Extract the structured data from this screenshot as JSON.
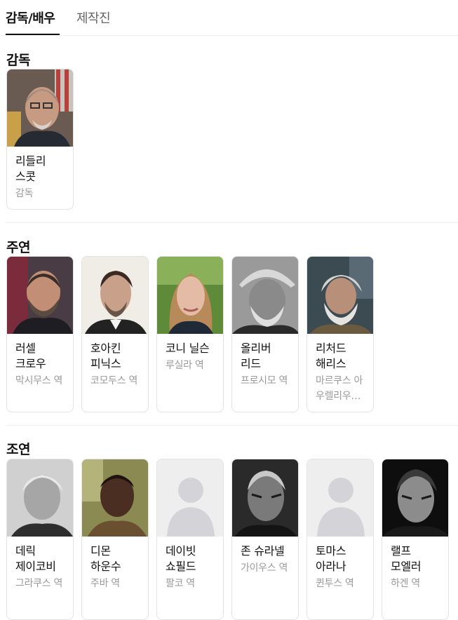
{
  "tabs": [
    {
      "label": "감독/배우"
    },
    {
      "label": "제작진"
    }
  ],
  "sections": {
    "director": {
      "title": "감독",
      "people": [
        {
          "name": "리들리 스콧",
          "role": "감독",
          "photo": "portrait"
        }
      ]
    },
    "lead": {
      "title": "주연",
      "people": [
        {
          "name": "러셀 크로우",
          "role": "막시무스 역",
          "photo": "portrait"
        },
        {
          "name": "호아킨 피닉스",
          "role": "코모두스 역",
          "photo": "portrait"
        },
        {
          "name": "코니 닐슨",
          "role": "루실라 역",
          "photo": "portrait"
        },
        {
          "name": "올리버 리드",
          "role": "프로시모 역",
          "photo": "portrait"
        },
        {
          "name": "리처드 해리스",
          "role": "마르쿠스 아우렐리우스 역",
          "photo": "portrait"
        }
      ]
    },
    "support": {
      "title": "조연",
      "people": [
        {
          "name": "데릭 제이코비",
          "role": "그라쿠스 역",
          "photo": "portrait"
        },
        {
          "name": "디몬 하운수",
          "role": "주바 역",
          "photo": "portrait"
        },
        {
          "name": "데이빗 쇼필드",
          "role": "팔코 역",
          "photo": "placeholder-avatar-icon"
        },
        {
          "name": "존 슈라넬",
          "role": "가이우스 역",
          "photo": "portrait"
        },
        {
          "name": "토마스 아라나",
          "role": "퀸투스 역",
          "photo": "placeholder-avatar-icon"
        },
        {
          "name": "랠프 모엘러",
          "role": "하겐 역",
          "photo": "portrait"
        }
      ]
    }
  }
}
